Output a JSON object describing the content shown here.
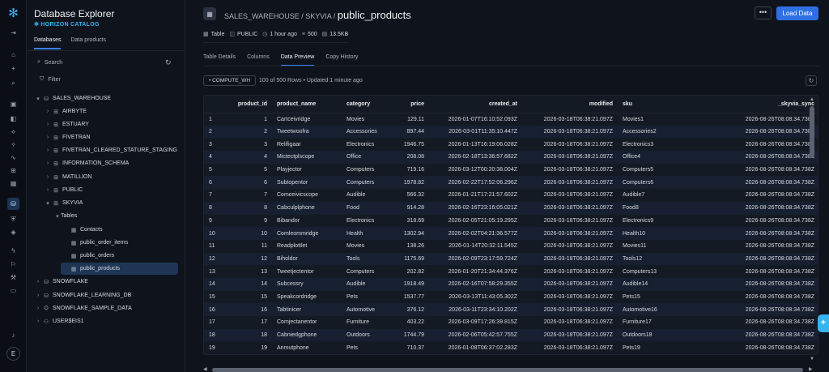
{
  "rail": {
    "icons": [
      "collapse-icon",
      "home-icon",
      "plus-icon",
      "search-icon",
      "projects-icon",
      "worksheet-icon",
      "graph-icon",
      "ai-icon",
      "activity-icon",
      "apps-icon",
      "grid-icon",
      "database-icon",
      "shield-icon",
      "compliance-icon",
      "spark-icon",
      "marketplace-icon",
      "tools-icon",
      "docs-icon",
      "bell-icon"
    ],
    "avatar_initial": "E"
  },
  "sidebar": {
    "title": "Database Explorer",
    "subtitle": "HORIZON CATALOG",
    "tabs": [
      "Databases",
      "Data products"
    ],
    "search_placeholder": "Search",
    "filter_label": "Filter",
    "tree": [
      {
        "label": "SALES_WAREHOUSE",
        "depth": 0,
        "chevron": "▾",
        "icon": "database"
      },
      {
        "label": "AIRBYTE",
        "depth": 1,
        "chevron": "›",
        "icon": "schema"
      },
      {
        "label": "ESTUARY",
        "depth": 1,
        "chevron": "›",
        "icon": "schema"
      },
      {
        "label": "FIVETRAN",
        "depth": 1,
        "chevron": "›",
        "icon": "schema"
      },
      {
        "label": "FIVETRAN_CLEARED_STATURE_STAGING",
        "depth": 1,
        "chevron": "›",
        "icon": "schema"
      },
      {
        "label": "INFORMATION_SCHEMA",
        "depth": 1,
        "chevron": "›",
        "icon": "schema"
      },
      {
        "label": "MATILLION",
        "depth": 1,
        "chevron": "›",
        "icon": "schema"
      },
      {
        "label": "PUBLIC",
        "depth": 1,
        "chevron": "›",
        "icon": "schema"
      },
      {
        "label": "SKYVIA",
        "depth": 1,
        "chevron": "▾",
        "icon": "schema"
      },
      {
        "label": "Tables",
        "depth": 2,
        "chevron": "▾",
        "icon": ""
      },
      {
        "label": "Contacts",
        "depth": 3,
        "chevron": "",
        "icon": "table"
      },
      {
        "label": "public_order_items",
        "depth": 3,
        "chevron": "",
        "icon": "table"
      },
      {
        "label": "public_orders",
        "depth": 3,
        "chevron": "",
        "icon": "table"
      },
      {
        "label": "public_products",
        "depth": 3,
        "chevron": "",
        "icon": "table",
        "selected": true
      },
      {
        "label": "SNOWFLAKE",
        "depth": 0,
        "chevron": "›",
        "icon": "database"
      },
      {
        "label": "SNOWFLAKE_LEARNING_DB",
        "depth": 0,
        "chevron": "›",
        "icon": "database"
      },
      {
        "label": "SNOWFLAKE_SAMPLE_DATA",
        "depth": 0,
        "chevron": "›",
        "icon": "share"
      },
      {
        "label": "USER$EIS1",
        "depth": 0,
        "chevron": "›",
        "icon": "user"
      }
    ]
  },
  "header": {
    "breadcrumb_path": "SALES_WAREHOUSE / SKYVIA / ",
    "current": "public_products",
    "more_label": "•••",
    "load_label": "Load Data"
  },
  "meta": {
    "type": "Table",
    "owner": "PUBLIC",
    "age": "1 hour ago",
    "rows": "500",
    "size": "13.5KB"
  },
  "tabs": [
    "Table Details",
    "Columns",
    "Data Preview",
    "Copy History"
  ],
  "preview": {
    "warehouse": "COMPUTE_WH",
    "row_info": "100 of 500 Rows • Updated 1 minute ago"
  },
  "table": {
    "columns": [
      "",
      "product_id",
      "product_name",
      "category",
      "price",
      "created_at",
      "modified",
      "sku",
      "_skyvia_sync"
    ],
    "rows": [
      [
        "1",
        "1",
        "Cartceivridge",
        "Movies",
        "129.11",
        "2026-01-07T16:10:52.093Z",
        "2026-03-18T06:38:21.097Z",
        "Movies1",
        "2026-08-26T08:08:34.738Z"
      ],
      [
        "2",
        "2",
        "Tweetwoofra",
        "Accessories",
        "897.44",
        "2026-03-01T11:35:10.447Z",
        "2026-03-18T06:38:21.097Z",
        "Accessories2",
        "2026-08-26T08:08:34.738Z"
      ],
      [
        "3",
        "3",
        "Relifigaar",
        "Electronics",
        "1946.75",
        "2026-01-13T16:19:06.028Z",
        "2026-03-18T06:38:21.097Z",
        "Electronics3",
        "2026-08-26T08:08:34.738Z"
      ],
      [
        "4",
        "4",
        "Mictectplscope",
        "Office",
        "208.08",
        "2026-02-18T13:36:57.682Z",
        "2026-03-18T06:38:21.097Z",
        "Office4",
        "2026-08-26T08:08:34.738Z"
      ],
      [
        "5",
        "5",
        "Playjector",
        "Computers",
        "719.16",
        "2026-03-12T00:20:38.004Z",
        "2026-03-18T06:38:21.097Z",
        "Computers5",
        "2026-08-26T08:08:34.738Z"
      ],
      [
        "6",
        "6",
        "Subtopentor",
        "Computers",
        "1978.82",
        "2026-02-22T17:52:06.296Z",
        "2026-03-18T06:38:21.097Z",
        "Computers6",
        "2026-08-26T08:08:34.738Z"
      ],
      [
        "7",
        "7",
        "Comceivicscope",
        "Audible",
        "566.32",
        "2026-01-21T17:21:57.602Z",
        "2026-03-18T06:38:21.097Z",
        "Audible7",
        "2026-08-26T08:08:34.738Z"
      ],
      [
        "8",
        "8",
        "Cabculplphone",
        "Food",
        "914.28",
        "2026-02-16T23:16:05.021Z",
        "2026-03-18T06:38:21.097Z",
        "Food8",
        "2026-08-26T08:08:34.738Z"
      ],
      [
        "9",
        "9",
        "Bibandor",
        "Electronics",
        "318.69",
        "2026-02-05T21:05:19.295Z",
        "2026-03-18T06:38:21.097Z",
        "Electronics9",
        "2026-08-26T08:08:34.738Z"
      ],
      [
        "10",
        "10",
        "Comleommridge",
        "Health",
        "1302.94",
        "2026-02-02T04:21:36.577Z",
        "2026-03-18T06:38:21.097Z",
        "Health10",
        "2026-08-26T08:08:34.738Z"
      ],
      [
        "11",
        "11",
        "Readplottlet",
        "Movies",
        "138.26",
        "2026-01-14T20:32:11.545Z",
        "2026-03-18T06:38:21.097Z",
        "Movies11",
        "2026-08-26T08:08:34.738Z"
      ],
      [
        "12",
        "12",
        "Biholdor",
        "Tools",
        "1175.69",
        "2026-02-09T23:17:59.724Z",
        "2026-03-18T06:38:21.097Z",
        "Tools12",
        "2026-08-26T08:08:34.738Z"
      ],
      [
        "13",
        "13",
        "Tweetjectentor",
        "Computers",
        "202.82",
        "2026-01-20T21:34:44.376Z",
        "2026-03-18T06:38:21.097Z",
        "Computers13",
        "2026-08-26T08:08:34.738Z"
      ],
      [
        "14",
        "14",
        "Subcessry",
        "Audible",
        "1918.49",
        "2026-02-16T07:58:29.355Z",
        "2026-03-18T06:38:21.097Z",
        "Audible14",
        "2026-08-26T08:08:34.738Z"
      ],
      [
        "15",
        "15",
        "Speakcordridge",
        "Pets",
        "1537.77",
        "2026-03-13T11:43:05.302Z",
        "2026-03-18T06:38:21.097Z",
        "Pets15",
        "2026-08-26T08:08:34.738Z"
      ],
      [
        "16",
        "16",
        "Tabtinicer",
        "Automotive",
        "376.12",
        "2026-03-11T23:34:10.202Z",
        "2026-03-18T06:38:21.097Z",
        "Automotive16",
        "2026-08-26T08:08:34.738Z"
      ],
      [
        "17",
        "17",
        "Comjectanentor",
        "Furniture",
        "403.22",
        "2026-03-09T17:26:39.815Z",
        "2026-03-18T06:38:21.097Z",
        "Furniture17",
        "2026-08-26T08:08:34.738Z"
      ],
      [
        "18",
        "18",
        "Cabniedgphone",
        "Outdoors",
        "1744.79",
        "2026-02-06T05:42:57.755Z",
        "2026-03-18T06:38:21.097Z",
        "Outdoors18",
        "2026-08-26T08:08:34.738Z"
      ],
      [
        "19",
        "19",
        "Anmutphone",
        "Pets",
        "710.37",
        "2026-01-08T06:37:02.283Z",
        "2026-03-18T06:38:21.097Z",
        "Pets19",
        "2026-08-26T08:08:34.738Z"
      ]
    ]
  }
}
